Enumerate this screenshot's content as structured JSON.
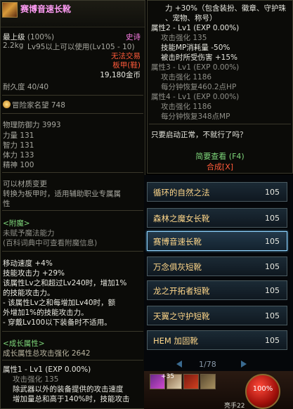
{
  "item": {
    "title": "赛博音速长靴",
    "grade": "最上级",
    "grade_pct": "(100%)",
    "rarity": "史诗",
    "weight": "2.2kg",
    "level_req": "Lv95以上可以使用(Lv105 - 10)",
    "trade": "无法交易",
    "type": "板甲(鞋)",
    "price": "19,180金币",
    "durability": "耐久度 40/40",
    "fame_label": "冒险家名望",
    "fame_value": "748",
    "stats": [
      {
        "label": "物理防御力",
        "value": "3993"
      },
      {
        "label": "力量",
        "value": "131"
      },
      {
        "label": "智力",
        "value": "131"
      },
      {
        "label": "体力",
        "value": "133"
      },
      {
        "label": "精神",
        "value": "100"
      }
    ],
    "material_change": [
      "可以材质变更",
      "转换为板甲时，适用辅助职业专属属",
      "性"
    ],
    "enchant": {
      "header": "<附魔>",
      "line1": "未赋予魔法能力",
      "line2": "(百科词典中可查看附魔信息)"
    },
    "effects": [
      "移动速度 +4%",
      "技能攻击力 +29%",
      "该属性Lv之和超过Lv240时，增加1%",
      "的技能攻击力。",
      "- 该属性Lv之和每增加Lv40时，额",
      "外增加1%的技能攻击力。",
      "- 穿戴Lv100以下装备时不适用。"
    ],
    "growth": {
      "header": "<成长属性>",
      "total": "成长属性总攻击强化 2642",
      "attr1": "属性1 - Lv1 (EXP 0.00%)",
      "attr1_atk": "攻击强化 135",
      "attr1_desc1": "除武器以外的装备提供的攻击速度",
      "attr1_desc2": "增加量总和高于140%时，技能攻击"
    }
  },
  "right_tooltip": {
    "lines": [
      "力 +30%（包含装扮、徽章、守护珠",
      "、宠物、称号）",
      "属性2 - Lv1 (EXP 0.00%)",
      "攻击强化 135",
      "技能MP消耗量 -50%",
      "被击时所受伤害 +15%",
      "属性3 - Lv1 (EXP 0.00%)",
      "攻击强化 1186",
      "每分钟恢复460.2点HP",
      "属性4 - Lv1 (EXP 0.00%)",
      "攻击强化 1186",
      "每分钟恢复348点MP"
    ],
    "quote": "只要启动正常，不就行了吗？",
    "brief_view": "简要查看 (F4)",
    "compose": "合成[X]"
  },
  "list": {
    "items": [
      {
        "name": "循环的自然之法",
        "level": "105"
      },
      {
        "name": "森林之魔女长靴",
        "level": "105"
      },
      {
        "name": "赛博音速长靴",
        "level": "105"
      },
      {
        "name": "万念俱灰短靴",
        "level": "105"
      },
      {
        "name": "龙之开拓者短靴",
        "level": "105"
      },
      {
        "name": "天翼之守护短靴",
        "level": "105"
      },
      {
        "name": "HEM 加固靴",
        "level": "105"
      }
    ],
    "page": "1/78"
  },
  "hud": {
    "hp": "100%",
    "skill_count": "+35",
    "label": "亮手22"
  },
  "colors": {
    "epic_pink": "#ff9cf5",
    "list_gold": "#ffd78a",
    "green": "#7ed67a",
    "red": "#ff5a3a"
  }
}
